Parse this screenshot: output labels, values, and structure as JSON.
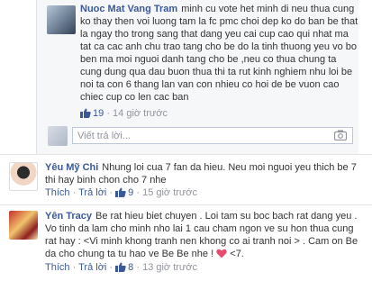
{
  "reply": {
    "author": "Nuoc Mat Vang Tram",
    "text": "minh cu vote het minh di neu thua cung ko thay then voi luong tam la fc pmc choi dep ko do ban be that la ngay tho trong sang that dang yeu cai cup cao qui nhat ma tat ca cac anh chu trao tang cho be do la tinh thuong yeu vo bo ben ma moi nguoi danh tang cho be ,neu co thua chung ta cung dung qua dau buon thua thi ta rut kinh nghiem nhu loi be noi ta con 6 thang lan van con nhieu co hoi de be vuon cao chiec cup co len cac ban",
    "likes": "19",
    "time": "14 giờ trước",
    "separator": "·"
  },
  "reply_input": {
    "placeholder": "Viết trả lời..."
  },
  "comments": [
    {
      "author": "Yêu Mỹ Chi",
      "text": "Nhung loi cua 7 fan da hieu. Neu moi nguoi yeu thich be 7 thi hay binh chon cho 7 nhe",
      "like_label": "Thích",
      "reply_label": "Trả lời",
      "likes": "9",
      "time": "15 giờ trước",
      "separator": "·"
    },
    {
      "author": "Yên Tracy",
      "text": "Be rat hieu biet chuyen . Loi tam su boc bach rat dang yeu . Vo tinh da lam cho minh nho lai 1 cau cham ngon ve su hon thua cung rat hay : <Vi minh khong tranh nen khong co ai tranh noi > . Cam on Be da cho chung ta tu hao ve Be Be nhe !",
      "text_end": "<7.",
      "like_label": "Thích",
      "reply_label": "Trả lời",
      "likes": "8",
      "time": "13 giờ trước",
      "separator": "·"
    }
  ],
  "colors": {
    "link": "#3b5998",
    "meta": "#90949c",
    "panel": "#f6f7f9",
    "heart": "#e74c6f"
  }
}
